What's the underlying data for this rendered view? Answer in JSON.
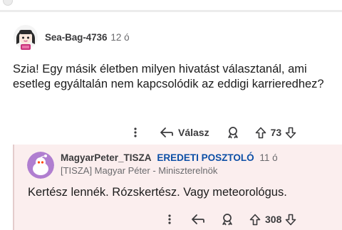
{
  "comment": {
    "author": "Sea-Bag-4736",
    "time": "12 ó",
    "body": "Szia! Egy másik életben milyen hivatást választanál, ami esetleg egyáltalán nem kapcsolódik az eddigi karrieredhez?",
    "actions": {
      "reply_label": "Válasz",
      "score": "73"
    }
  },
  "reply": {
    "author": "MagyarPeter_TISZA",
    "op_badge": "EREDETI POSZTOLÓ",
    "time": "11 ó",
    "flair": "[TISZA] Magyar Péter - Miniszterelnök",
    "body": "Kertész lennék. Rózskertész. Vagy meteorológus.",
    "actions": {
      "score": "308"
    }
  },
  "colors": {
    "op_badge": "#0d4fa6",
    "reply_background": "#fbeeee",
    "avatar_accent": "#c8327a",
    "reply_avatar": "#b07ed0"
  }
}
